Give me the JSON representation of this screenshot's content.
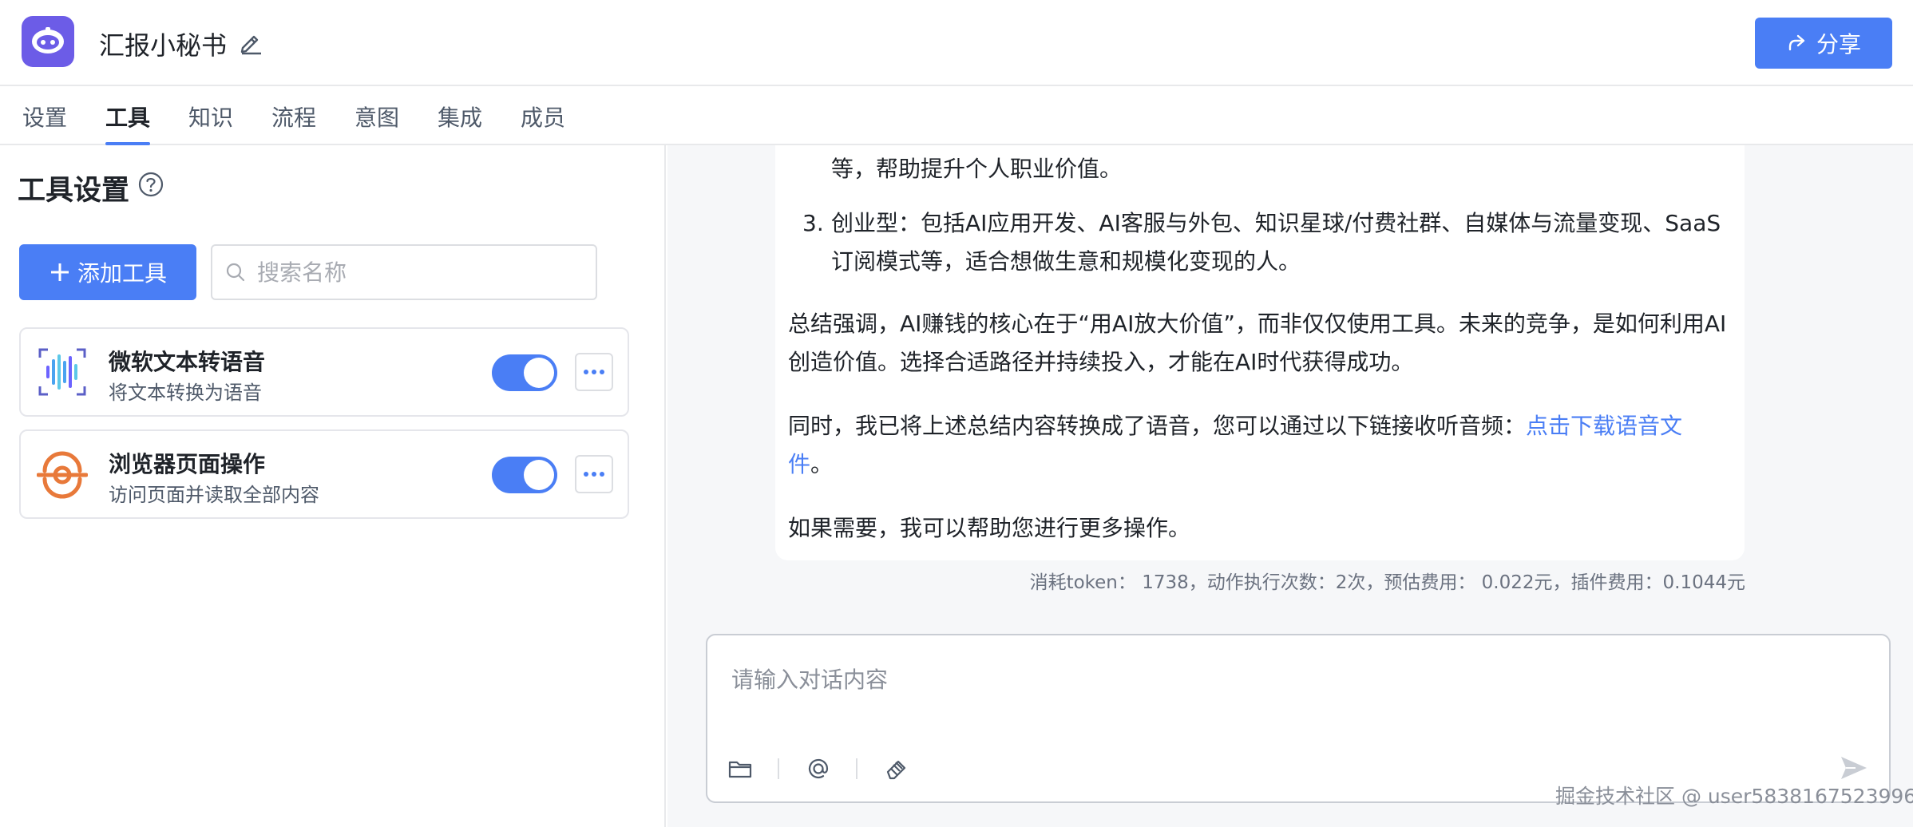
{
  "header": {
    "app_name": "汇报小秘书",
    "share_label": "分享"
  },
  "tabs": [
    {
      "label": "设置"
    },
    {
      "label": "工具"
    },
    {
      "label": "知识"
    },
    {
      "label": "流程"
    },
    {
      "label": "意图"
    },
    {
      "label": "集成"
    },
    {
      "label": "成员"
    }
  ],
  "active_tab": "工具",
  "tool_settings": {
    "title": "工具设置",
    "add_button": "添加工具",
    "search_placeholder": "搜索名称",
    "tools": [
      {
        "name": "微软文本转语音",
        "description": "将文本转换为语音",
        "enabled": true,
        "icon": "soundwave-icon"
      },
      {
        "name": "浏览器页面操作",
        "description": "访问页面并读取全部内容",
        "enabled": true,
        "icon": "browser-icon"
      }
    ]
  },
  "chat": {
    "line_top": "等，帮助提升个人职业价值。",
    "item3_number": "3.",
    "item3_line1": "创业型：包括AI应用开发、AI客服与外包、知识星球/付费社群、自媒体与流量变现、SaaS",
    "item3_line2": "订阅模式等，适合想做生意和规模化变现的人。",
    "summary_line1": "总结强调，AI赚钱的核心在于“用AI放大价值”，而非仅仅使用工具。未来的竞争，是如何利用AI",
    "summary_line2": "创造价值。选择合适路径并持续投入，才能在AI时代获得成功。",
    "audio_line1_prefix": "同时，我已将上述总结内容转换成了语音，您可以通过以下链接收听音频：",
    "audio_link_part1": "点击下载语音文",
    "audio_link_part2": "件",
    "audio_line2_suffix": "。",
    "closing": "如果需要，我可以帮助您进行更多操作。",
    "usage": "消耗token： 1738，动作执行次数：2次，预估费用： 0.022元，插件费用：0.1044元"
  },
  "composer": {
    "placeholder": "请输入对话内容"
  },
  "watermark": "掘金技术社区 @ user5838167523996",
  "colors": {
    "accent": "#4a7ef5",
    "logo": "#6c5ce7",
    "browser_icon": "#e8793a"
  }
}
